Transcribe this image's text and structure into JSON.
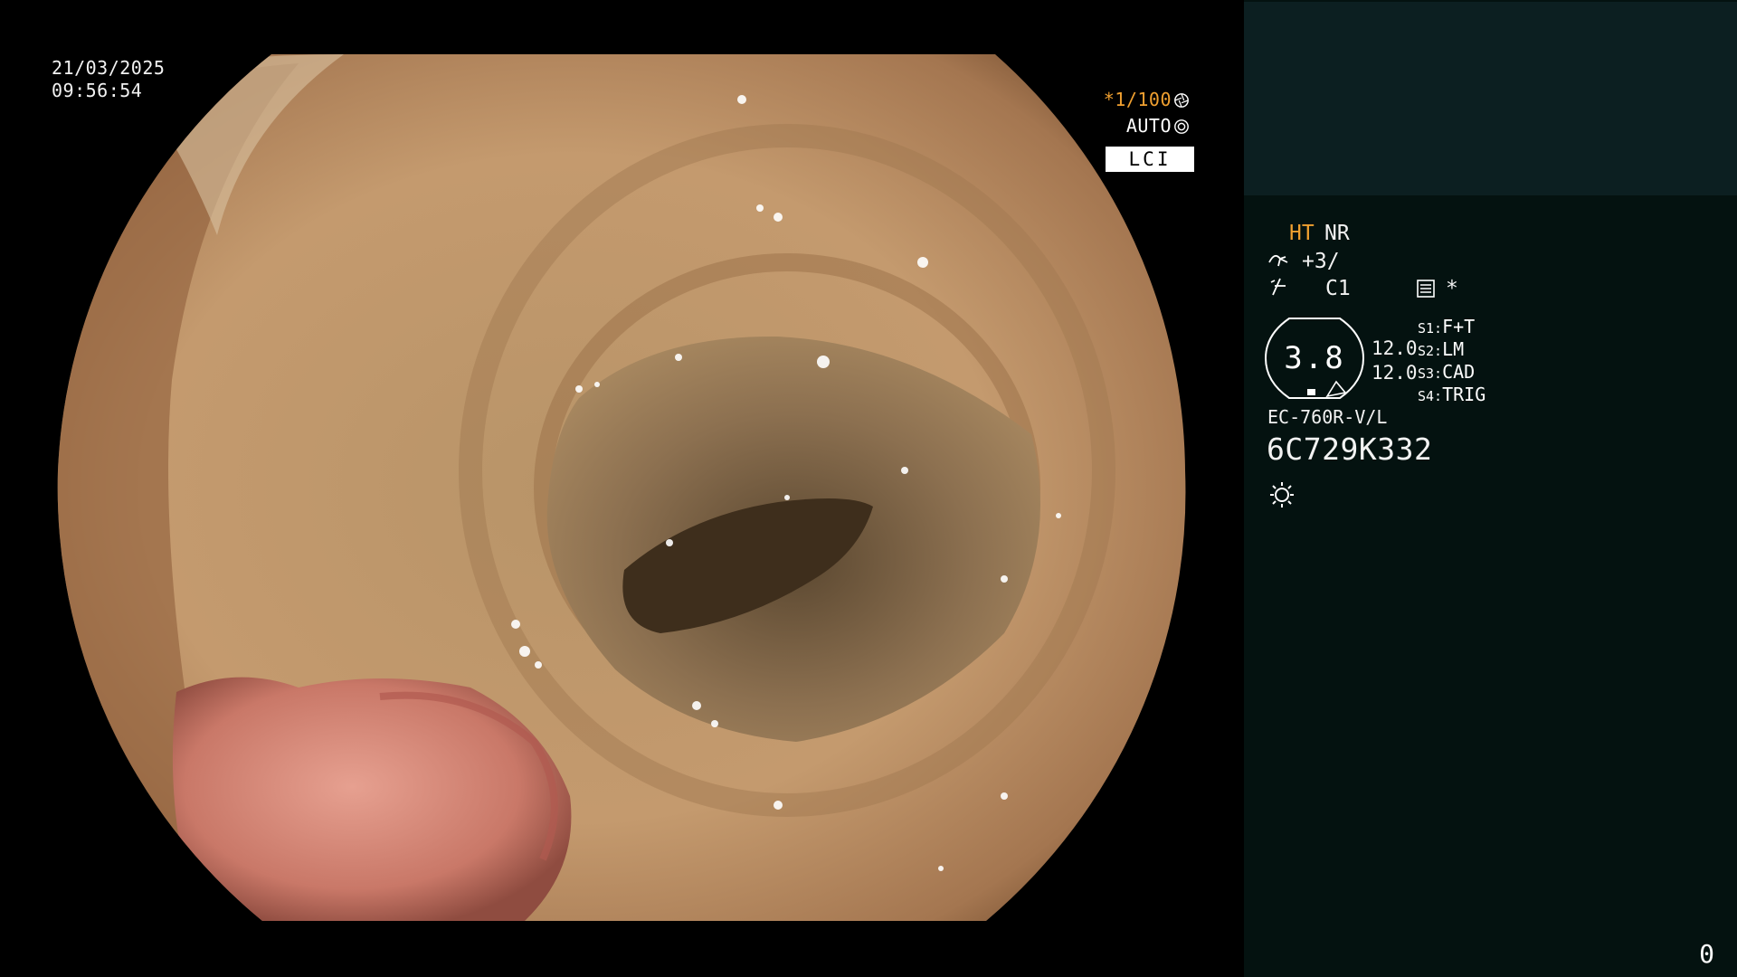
{
  "overlay": {
    "date": "21/03/2025",
    "time": "09:56:54",
    "shutter_prefix": "*1/100",
    "iris": "AUTO",
    "mode": "LCI"
  },
  "panel": {
    "ht": "HT",
    "nr": "NR",
    "enhancement": "+3/",
    "color": "C1",
    "star": "*",
    "zoom": "3.8",
    "value_top": "12.0",
    "value_bottom": "12.0",
    "switches": [
      {
        "key": "S1:",
        "value": "F+T"
      },
      {
        "key": "S2:",
        "value": "LM"
      },
      {
        "key": "S3:",
        "value": "CAD"
      },
      {
        "key": "S4:",
        "value": "TRIG"
      }
    ],
    "scope_model": "EC-760R-V/L",
    "serial": "6C729K332",
    "page": "0"
  },
  "colors": {
    "accent_orange": "#f0a030",
    "panel_bg": "#041210",
    "panel_top_bg": "#0c1f21"
  },
  "icons": {
    "shutter": "aperture-icon",
    "iris": "iris-icon",
    "enhancement": "structure-enhancement-icon",
    "color": "color-enhancement-icon",
    "config": "config-icon",
    "light": "light-sun-icon"
  }
}
